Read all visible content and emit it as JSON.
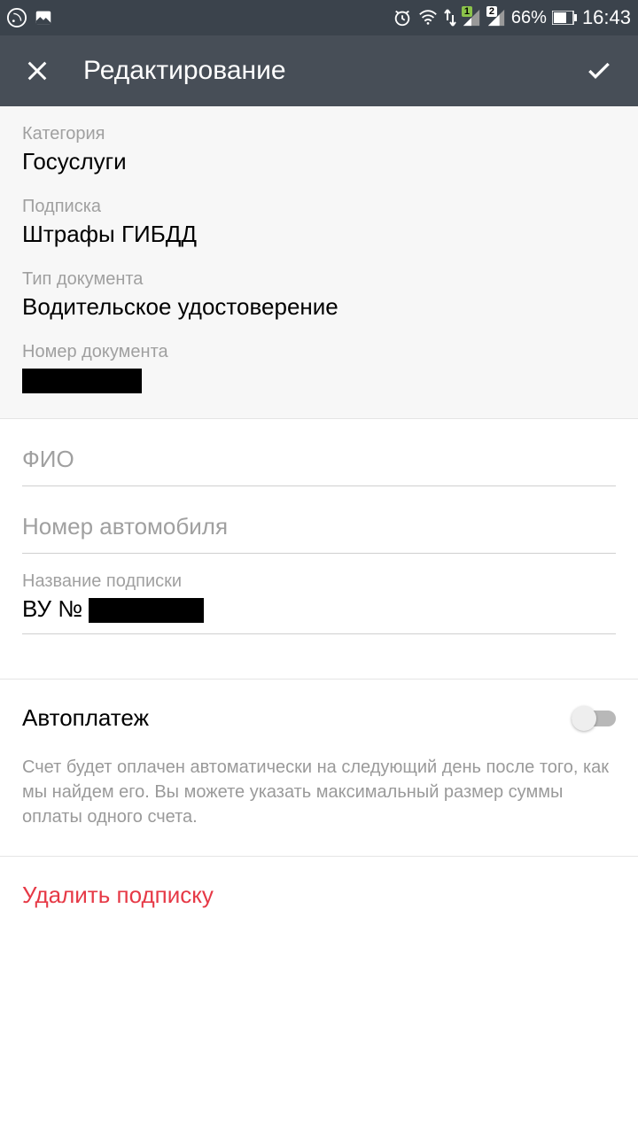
{
  "status": {
    "battery_pct": "66%",
    "time": "16:43",
    "sim1": "1",
    "sim2": "2"
  },
  "header": {
    "title": "Редактирование"
  },
  "info": {
    "category_label": "Категория",
    "category_value": "Госуслуги",
    "subscription_label": "Подписка",
    "subscription_value": "Штрафы ГИБДД",
    "doc_type_label": "Тип документа",
    "doc_type_value": "Водительское удостоверение",
    "doc_number_label": "Номер документа",
    "doc_number_value": ""
  },
  "form": {
    "fio_placeholder": "ФИО",
    "fio_value": "",
    "car_placeholder": "Номер автомобиля",
    "car_value": "",
    "sub_name_label": "Название подписки",
    "sub_name_prefix": "ВУ № "
  },
  "autopay": {
    "title": "Автоплатеж",
    "enabled": false,
    "desc": "Счет будет оплачен автоматически на следующий день после того, как мы найдем его. Вы можете указать максимальный размер суммы оплаты одного счета."
  },
  "delete": {
    "label": "Удалить подписку"
  }
}
